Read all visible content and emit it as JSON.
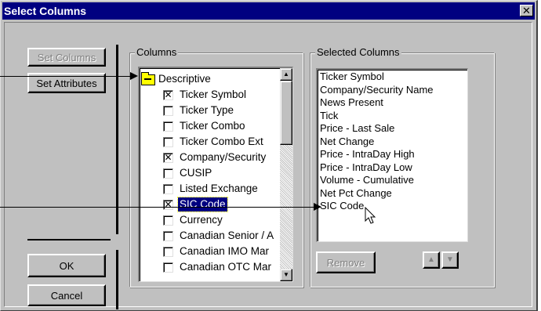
{
  "window": {
    "title": "Select Columns",
    "close_glyph": "✕"
  },
  "left_buttons": {
    "set_columns": "Set Columns",
    "set_attributes": "Set Attributes",
    "ok": "OK",
    "cancel": "Cancel"
  },
  "columns_group": {
    "label": "Columns",
    "folder": "Descriptive",
    "items": [
      {
        "label": "Ticker Symbol",
        "checked": true
      },
      {
        "label": "Ticker Type",
        "checked": false
      },
      {
        "label": "Ticker Combo",
        "checked": false
      },
      {
        "label": "Ticker Combo Ext",
        "checked": false
      },
      {
        "label": "Company/Security",
        "checked": true
      },
      {
        "label": "CUSIP",
        "checked": false
      },
      {
        "label": "Listed Exchange",
        "checked": false
      },
      {
        "label": "SIC Code",
        "checked": true,
        "selected": true
      },
      {
        "label": "Currency",
        "checked": false
      },
      {
        "label": "Canadian Senior / A",
        "checked": false
      },
      {
        "label": "Canadian IMO Mar",
        "checked": false
      },
      {
        "label": "Canadian OTC Mar",
        "checked": false
      }
    ],
    "check_glyph": "✕",
    "scroll_up_glyph": "▲",
    "scroll_down_glyph": "▼"
  },
  "selected_group": {
    "label": "Selected Columns",
    "items": [
      "Ticker Symbol",
      "Company/Security Name",
      "News Present",
      "Tick",
      "Price - Last Sale",
      "Net Change",
      "Price - IntraDay High",
      "Price - IntraDay Low",
      "Volume - Cumulative",
      "Net Pct Change",
      "SIC Code"
    ],
    "remove_label": "Remove",
    "move_up_glyph": "▲",
    "move_down_glyph": "▼"
  },
  "colors": {
    "face": "#c0c0c0",
    "titlebar": "#000080",
    "selection": "#000080"
  }
}
